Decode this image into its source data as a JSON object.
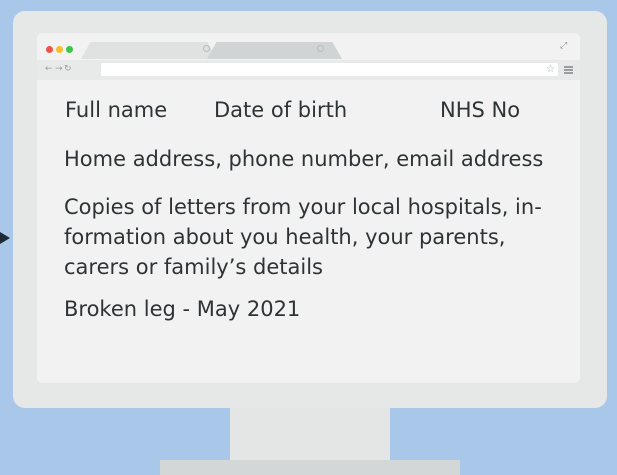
{
  "record": {
    "full_name": "Full name",
    "date_of_birth": "Date of birth",
    "nhs_no": "NHS No",
    "contact": "Home address, phone number, email address",
    "letters_line1": "Copies of letters from your local hospitals, in-",
    "letters_line2": "formation about you health, your parents,",
    "letters_line3": "carers or family’s details",
    "event": "Broken leg  - May 2021"
  },
  "colors": {
    "background": "#a9c7e9",
    "monitor": "#e6e8e8",
    "window": "#f2f2f2",
    "text": "#2e3336"
  },
  "icons": {
    "window_controls": [
      "close-dot-icon",
      "minimize-dot-icon",
      "maximize-dot-icon"
    ],
    "nav": [
      "back-arrow-icon",
      "forward-arrow-icon",
      "reload-icon"
    ],
    "toolbar_right": [
      "star-icon",
      "menu-icon"
    ],
    "expand": "expand-icon",
    "pointer": "arrow-pointer-icon"
  }
}
